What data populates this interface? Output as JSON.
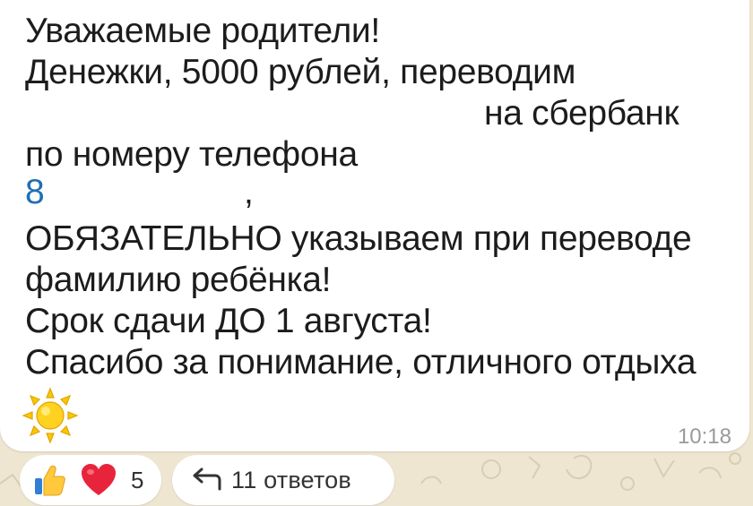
{
  "message": {
    "greeting": "Уважаемые родители!",
    "line_1": "Денежки, 5000 рублей, переводим",
    "line_2": "на сбербанк",
    "line_3": "по номеру телефона",
    "phone_prefix": "8",
    "phone_comma": ",",
    "line_5": "ОБЯЗАТЕЛЬНО указываем при переводе",
    "line_6": "фамилию ребёнка!",
    "line_7": "Срок сдачи ДО 1 августа!",
    "line_8": "Спасибо за понимание, отличного отдыха",
    "emoji": "sun-emoji",
    "time": "10:18"
  },
  "reactions": {
    "icons": [
      "thumbs-up-icon",
      "red-heart-icon"
    ],
    "count": "5"
  },
  "replies": {
    "icon": "reply-arrow-icon",
    "label": "11 ответов"
  },
  "colors": {
    "chat_background": "#efe6d2",
    "bubble": "#ffffff",
    "link": "#1e6fb5",
    "timestamp": "#9a9a9a"
  }
}
